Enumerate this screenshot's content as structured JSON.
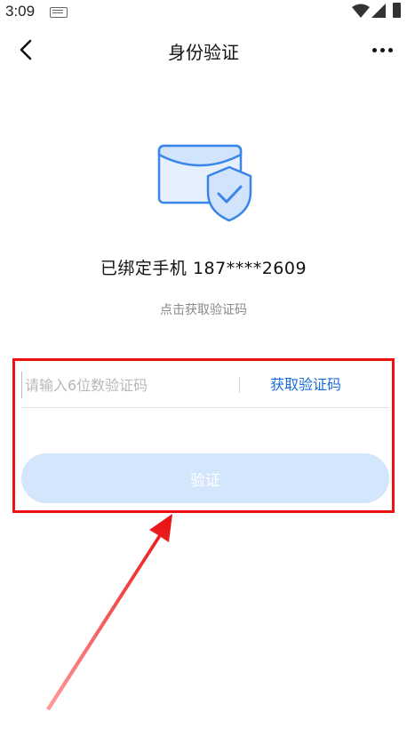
{
  "status_bar": {
    "time": "3:09"
  },
  "header": {
    "title": "身份验证"
  },
  "bound_phone": "已绑定手机  187****2609",
  "hint": "点击获取验证码",
  "code_input": {
    "placeholder": "请输入6位数验证码",
    "value": ""
  },
  "get_code_label": "获取验证码",
  "verify_button_label": "验证",
  "colors": {
    "link": "#1a6bd8",
    "button_disabled": "#d4e6fc",
    "annotation": "#ee1111"
  }
}
